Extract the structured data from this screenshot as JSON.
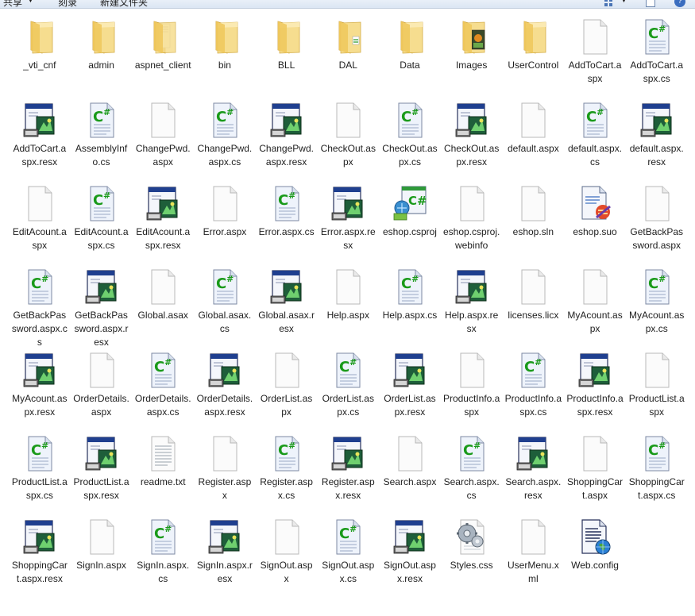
{
  "toolbar": {
    "share": "共享",
    "burn": "刻录",
    "new_folder": "新建文件夹"
  },
  "files": [
    {
      "name": "_vti_cnf",
      "icon": "folder"
    },
    {
      "name": "admin",
      "icon": "folder"
    },
    {
      "name": "aspnet_client",
      "icon": "folder-docs"
    },
    {
      "name": "bin",
      "icon": "folder"
    },
    {
      "name": "BLL",
      "icon": "folder"
    },
    {
      "name": "DAL",
      "icon": "folder-green"
    },
    {
      "name": "Data",
      "icon": "folder"
    },
    {
      "name": "Images",
      "icon": "folder-images"
    },
    {
      "name": "UserControl",
      "icon": "folder"
    },
    {
      "name": "AddToCart.aspx",
      "icon": "blank"
    },
    {
      "name": "AddToCart.aspx.cs",
      "icon": "csharp"
    },
    {
      "name": "AddToCart.aspx.resx",
      "icon": "resx"
    },
    {
      "name": "AssemblyInfo.cs",
      "icon": "csharp"
    },
    {
      "name": "ChangePwd.aspx",
      "icon": "blank"
    },
    {
      "name": "ChangePwd.aspx.cs",
      "icon": "csharp"
    },
    {
      "name": "ChangePwd.aspx.resx",
      "icon": "resx"
    },
    {
      "name": "CheckOut.aspx",
      "icon": "blank"
    },
    {
      "name": "CheckOut.aspx.cs",
      "icon": "csharp"
    },
    {
      "name": "CheckOut.aspx.resx",
      "icon": "resx"
    },
    {
      "name": "default.aspx",
      "icon": "blank"
    },
    {
      "name": "default.aspx.cs",
      "icon": "csharp"
    },
    {
      "name": "default.aspx.resx",
      "icon": "resx"
    },
    {
      "name": "EditAcount.aspx",
      "icon": "blank"
    },
    {
      "name": "EditAcount.aspx.cs",
      "icon": "csharp"
    },
    {
      "name": "EditAcount.aspx.resx",
      "icon": "resx"
    },
    {
      "name": "Error.aspx",
      "icon": "blank"
    },
    {
      "name": "Error.aspx.cs",
      "icon": "csharp"
    },
    {
      "name": "Error.aspx.resx",
      "icon": "resx"
    },
    {
      "name": "eshop.csproj",
      "icon": "csproj"
    },
    {
      "name": "eshop.csproj.webinfo",
      "icon": "blank"
    },
    {
      "name": "eshop.sln",
      "icon": "blank"
    },
    {
      "name": "eshop.suo",
      "icon": "suo"
    },
    {
      "name": "GetBackPassword.aspx",
      "icon": "blank"
    },
    {
      "name": "GetBackPassword.aspx.cs",
      "icon": "csharp"
    },
    {
      "name": "GetBackPassword.aspx.resx",
      "icon": "resx"
    },
    {
      "name": "Global.asax",
      "icon": "blank"
    },
    {
      "name": "Global.asax.cs",
      "icon": "csharp"
    },
    {
      "name": "Global.asax.resx",
      "icon": "resx"
    },
    {
      "name": "Help.aspx",
      "icon": "blank"
    },
    {
      "name": "Help.aspx.cs",
      "icon": "csharp"
    },
    {
      "name": "Help.aspx.resx",
      "icon": "resx"
    },
    {
      "name": "licenses.licx",
      "icon": "blank"
    },
    {
      "name": "MyAcount.aspx",
      "icon": "blank"
    },
    {
      "name": "MyAcount.aspx.cs",
      "icon": "csharp"
    },
    {
      "name": "MyAcount.aspx.resx",
      "icon": "resx"
    },
    {
      "name": "OrderDetails.aspx",
      "icon": "blank"
    },
    {
      "name": "OrderDetails.aspx.cs",
      "icon": "csharp"
    },
    {
      "name": "OrderDetails.aspx.resx",
      "icon": "resx"
    },
    {
      "name": "OrderList.aspx",
      "icon": "blank"
    },
    {
      "name": "OrderList.aspx.cs",
      "icon": "csharp"
    },
    {
      "name": "OrderList.aspx.resx",
      "icon": "resx"
    },
    {
      "name": "ProductInfo.aspx",
      "icon": "blank"
    },
    {
      "name": "ProductInfo.aspx.cs",
      "icon": "csharp"
    },
    {
      "name": "ProductInfo.aspx.resx",
      "icon": "resx"
    },
    {
      "name": "ProductList.aspx",
      "icon": "blank"
    },
    {
      "name": "ProductList.aspx.cs",
      "icon": "csharp"
    },
    {
      "name": "ProductList.aspx.resx",
      "icon": "resx"
    },
    {
      "name": "readme.txt",
      "icon": "text"
    },
    {
      "name": "Register.aspx",
      "icon": "blank"
    },
    {
      "name": "Register.aspx.cs",
      "icon": "csharp"
    },
    {
      "name": "Register.aspx.resx",
      "icon": "resx"
    },
    {
      "name": "Search.aspx",
      "icon": "blank"
    },
    {
      "name": "Search.aspx.cs",
      "icon": "csharp"
    },
    {
      "name": "Search.aspx.resx",
      "icon": "resx"
    },
    {
      "name": "ShoppingCart.aspx",
      "icon": "blank"
    },
    {
      "name": "ShoppingCart.aspx.cs",
      "icon": "csharp"
    },
    {
      "name": "ShoppingCart.aspx.resx",
      "icon": "resx"
    },
    {
      "name": "SignIn.aspx",
      "icon": "blank"
    },
    {
      "name": "SignIn.aspx.cs",
      "icon": "csharp"
    },
    {
      "name": "SignIn.aspx.resx",
      "icon": "resx"
    },
    {
      "name": "SignOut.aspx",
      "icon": "blank"
    },
    {
      "name": "SignOut.aspx.cs",
      "icon": "csharp"
    },
    {
      "name": "SignOut.aspx.resx",
      "icon": "resx"
    },
    {
      "name": "Styles.css",
      "icon": "css"
    },
    {
      "name": "UserMenu.xml",
      "icon": "blank"
    },
    {
      "name": "Web.config",
      "icon": "config"
    }
  ],
  "colors": {
    "folder": "#f2d27a",
    "csharp_green": "#1a9a1a",
    "resx_blue": "#1f3f8f"
  }
}
